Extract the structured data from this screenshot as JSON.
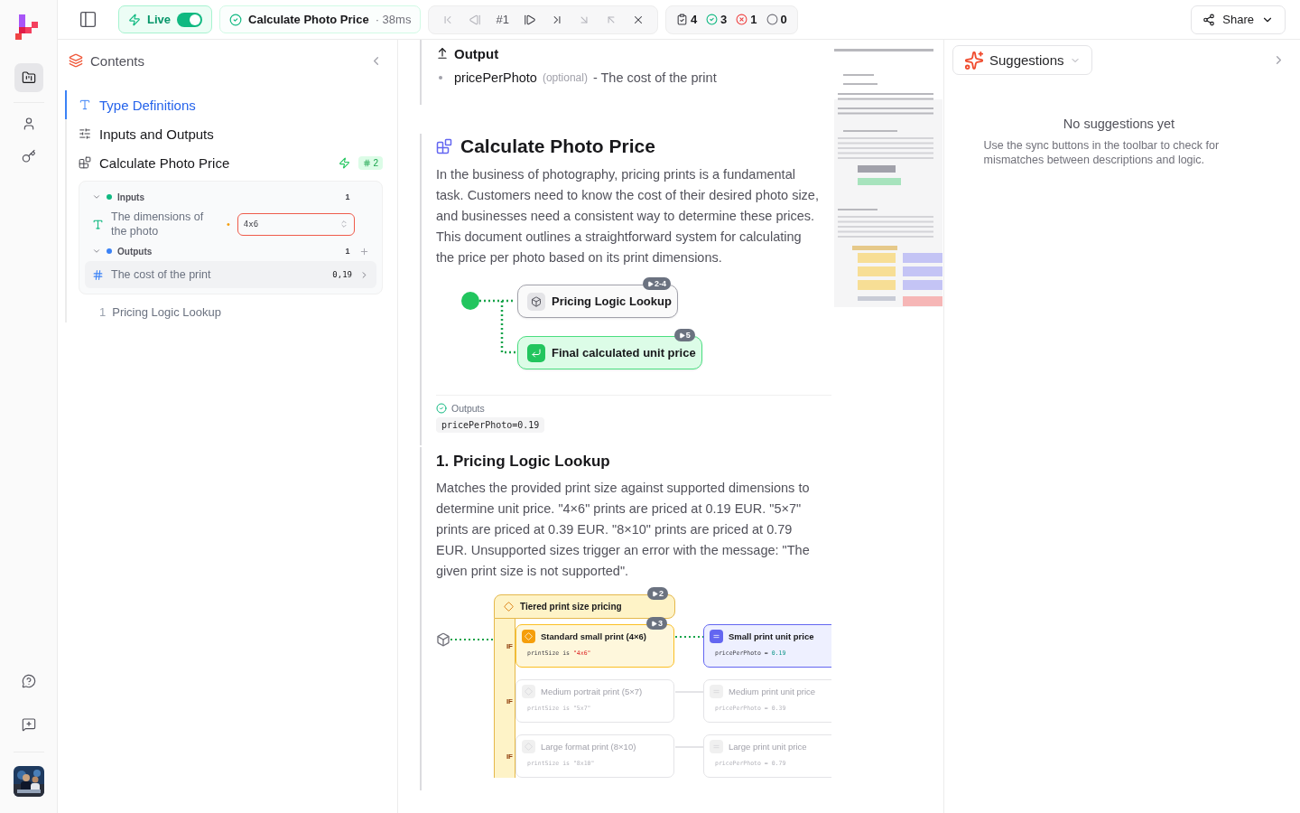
{
  "rail": {
    "items": [
      {
        "kind": "folder",
        "selected": true
      },
      {
        "kind": "user",
        "selected": false
      },
      {
        "kind": "key",
        "selected": false
      }
    ],
    "footer": [
      {
        "kind": "help"
      },
      {
        "kind": "feedback"
      }
    ]
  },
  "toolbar": {
    "live": {
      "label": "Live",
      "on": true
    },
    "run": {
      "label": "Calculate Photo Price",
      "duration": "· 38ms"
    },
    "nav_before": [
      {
        "kind": "first",
        "disabled": true
      },
      {
        "kind": "prev",
        "disabled": true
      }
    ],
    "step_label": "#1",
    "nav_after": [
      {
        "kind": "next",
        "disabled": false
      },
      {
        "kind": "last",
        "disabled": false
      },
      {
        "kind": "step_into",
        "disabled": true
      },
      {
        "kind": "step_out",
        "disabled": true
      },
      {
        "kind": "close",
        "disabled": false
      }
    ],
    "counts": [
      {
        "kind": "tasks",
        "value": "4"
      },
      {
        "kind": "passed",
        "value": "3"
      },
      {
        "kind": "failed",
        "value": "1"
      },
      {
        "kind": "pending",
        "value": "0"
      }
    ],
    "share": "Share"
  },
  "sidebar": {
    "title": "Contents",
    "items": [
      {
        "kind": "type",
        "label": "Type Definitions",
        "selected": true
      },
      {
        "kind": "io",
        "label": "Inputs and Outputs",
        "selected": false
      },
      {
        "kind": "function",
        "label": "Calculate Photo Price",
        "selected": false,
        "badge": "2"
      }
    ],
    "groups": [
      {
        "kind": "inputs",
        "label": "Inputs",
        "count": "1",
        "expanded": true,
        "fields": [
          {
            "kind": "text",
            "label": "The dimensions of the photo",
            "required_mark": "•",
            "value": "4x6"
          }
        ]
      },
      {
        "kind": "outputs",
        "label": "Outputs",
        "count": "1",
        "expanded": true,
        "fields": [
          {
            "kind": "number",
            "label": "The cost of the print",
            "value": "0,19"
          }
        ]
      }
    ],
    "steps": [
      {
        "number": "1",
        "label": "Pricing Logic Lookup"
      }
    ]
  },
  "document": {
    "output": {
      "heading": "Output",
      "params": [
        {
          "name": "pricePerPhoto",
          "note": "(optional)",
          "description": "- The cost of the print"
        }
      ]
    },
    "function": {
      "title": "Calculate Photo Price",
      "description": "In the business of photography, pricing prints is a fundamental task. Customers need to know the cost of their desired photo size, and businesses need a consistent way to determine these prices. This document outlines a straightforward system for calculating the price per photo based on its print dimensions.",
      "flow": [
        {
          "kind": "step",
          "label": "Pricing Logic Lookup",
          "badge": "2-4"
        },
        {
          "kind": "return",
          "label": "Final calculated unit price",
          "badge": "5"
        }
      ],
      "outputs_label": "Outputs",
      "result": "pricePerPhoto=0.19"
    },
    "step": {
      "title": "1. Pricing Logic Lookup",
      "description": "Matches the provided print size against supported dimensions to determine unit price. \"4×6\" prints are priced at 0.19 EUR. \"5×7\" prints are priced at 0.39 EUR. \"8×10\" prints are priced at 0.79 EUR. Unsupported sizes trigger an error with the message: \"The given print size is not supported\".",
      "decision": {
        "label": "Tiered print size pricing",
        "badge": "2",
        "branches": [
          {
            "gate": "IF",
            "condition": "Standard small print (4×6)",
            "badge": "3",
            "active": true,
            "rule": {
              "field": "printSize",
              "op": "is",
              "value": "\"4x6\""
            },
            "result": "Small print unit price",
            "assign": {
              "field": "pricePerPhoto",
              "op": "=",
              "value": "0.19"
            }
          },
          {
            "gate": "IF",
            "condition": "Medium portrait print (5×7)",
            "active": false,
            "rule": {
              "field": "printSize",
              "op": "is",
              "value": "\"5x7\""
            },
            "result": "Medium print unit price",
            "assign": {
              "field": "pricePerPhoto",
              "op": "=",
              "value": "0.39"
            }
          },
          {
            "gate": "IF",
            "condition": "Large format print (8×10)",
            "active": false,
            "rule": {
              "field": "printSize",
              "op": "is",
              "value": "\"8x10\""
            },
            "result": "Large print unit price",
            "assign": {
              "field": "pricePerPhoto",
              "op": "=",
              "value": "0.79"
            }
          }
        ]
      }
    }
  },
  "suggestions": {
    "label": "Suggestions",
    "empty_title": "No suggestions yet",
    "empty_text": "Use the sync buttons in the toolbar to check for mismatches between descriptions and logic."
  }
}
